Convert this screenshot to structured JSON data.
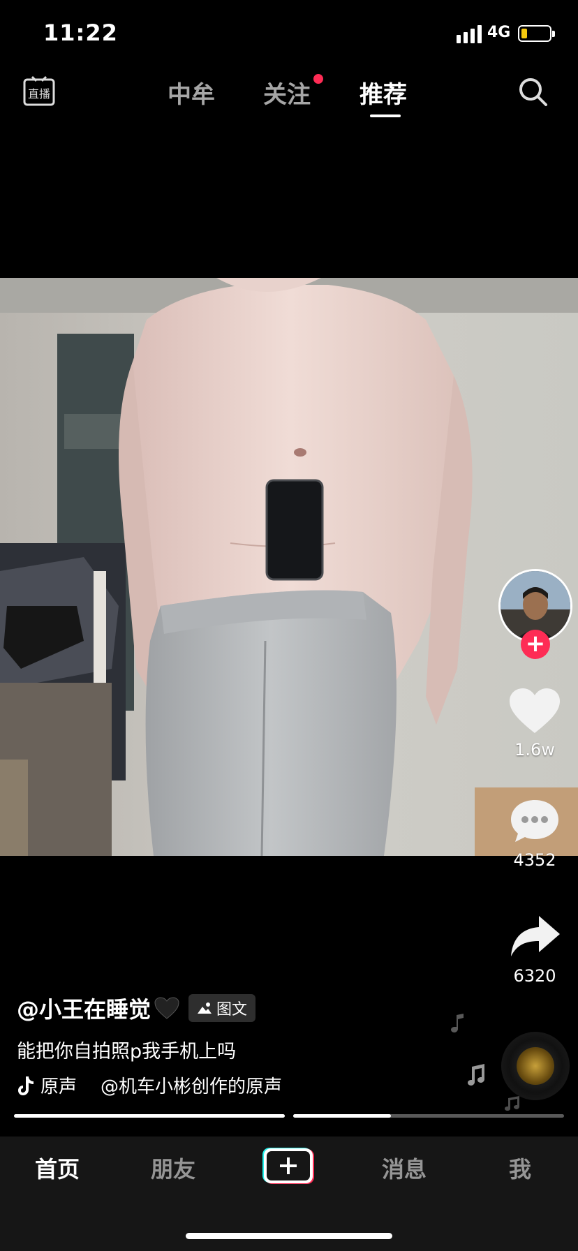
{
  "status_bar": {
    "time": "11:22",
    "network": "4G",
    "battery_fraction": 0.2
  },
  "top_nav": {
    "tabs": [
      {
        "label": "中牟",
        "active": false
      },
      {
        "label": "关注",
        "active": false,
        "has_dot": true
      },
      {
        "label": "推荐",
        "active": true
      }
    ],
    "live_icon": "live-icon",
    "search_icon": "search-icon"
  },
  "post": {
    "author": "@小王在睡觉",
    "type_tag": "图文",
    "description": "能把你自拍照p我手机上吗",
    "music_source": "原声",
    "music_credit": "@机车小彬创作的原声",
    "progress": [
      1.0,
      0.36
    ]
  },
  "actions": {
    "likes": "1.6w",
    "comments": "4352",
    "shares": "6320"
  },
  "bottom_nav": {
    "items": [
      {
        "label": "首页",
        "active": true
      },
      {
        "label": "朋友",
        "active": false
      },
      {
        "label": "消息",
        "active": false
      },
      {
        "label": "我",
        "active": false
      }
    ]
  },
  "colors": {
    "accent": "#fe2c55",
    "background": "#000000",
    "nav_bg": "#161616"
  }
}
